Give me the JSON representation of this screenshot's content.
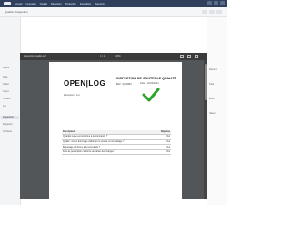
{
  "app": {
    "nav": [
      "Accueil",
      "Inventaire",
      "Qualité",
      "Réception",
      "Production",
      "Expédition",
      "Rapports"
    ]
  },
  "subbar": {
    "crumb": "Qualité / Inspection"
  },
  "sidebar": {
    "items": [
      {
        "label": "Filtres",
        "active": false
      },
      {
        "label": "Date",
        "active": false
      },
      {
        "label": "Statut",
        "active": false
      },
      {
        "label": "Client",
        "active": false
      },
      {
        "label": "Produit",
        "active": false
      },
      {
        "label": "Lot",
        "active": false
      },
      {
        "label": "Inspection",
        "active": true
      },
      {
        "label": "Rapports",
        "active": false
      },
      {
        "label": "Archives",
        "active": false
      }
    ]
  },
  "rightcol": {
    "labels": [
      "Résumé",
      "Total",
      "Écart",
      "Valeur"
    ]
  },
  "pdf": {
    "filename": "inspection-qualite.pdf",
    "pages": "1 / 1",
    "zoom": "100%"
  },
  "document": {
    "brand": "OPEN|LOG",
    "title": "INSPECTION DE CONTRÔLE QUALITÉ",
    "ref": "Réf : IQ-0001",
    "date": "Date : 12/03/2024",
    "subject": "Réception - Lot",
    "table": {
      "headers": [
        "Description",
        "Réponse"
      ],
      "rows": [
        [
          "Quantité reçue est conforme à la commande ?",
          "Oui"
        ],
        [
          "Qualité : Aucun dommage visible sur le produit ou l'emballage ?",
          "Oui"
        ],
        [
          "Étiquetage conforme à la commande ?",
          "Oui"
        ],
        [
          "Date de péremption conforme au cahier des charges ?",
          "Oui"
        ]
      ]
    },
    "status_color": "#2aa52a"
  }
}
